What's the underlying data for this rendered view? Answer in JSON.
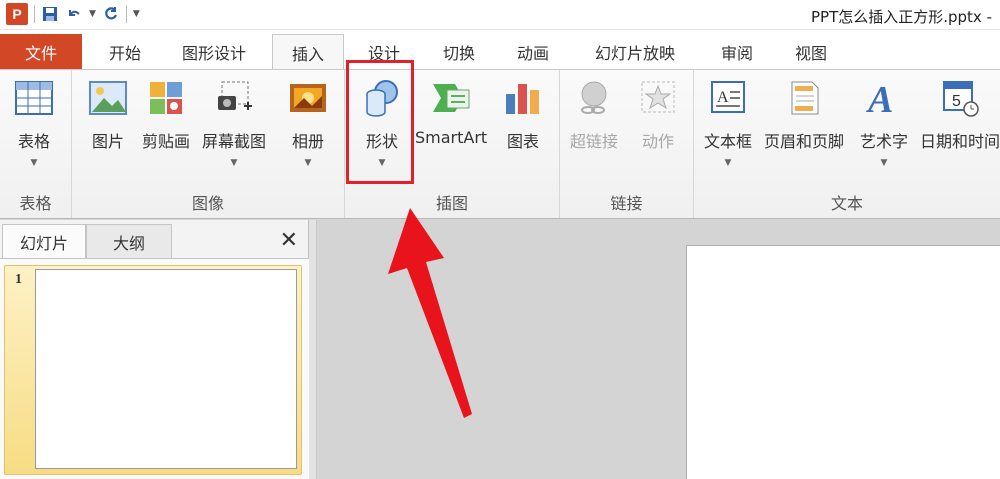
{
  "window": {
    "title": "PPT怎么插入正方形.pptx -",
    "app_icon_letter": "P"
  },
  "file_tab": "文件",
  "tabs": [
    "开始",
    "图形设计",
    "插入",
    "设计",
    "切换",
    "动画",
    "幻灯片放映",
    "审阅",
    "视图"
  ],
  "active_tab": "插入",
  "ribbon": {
    "groups": {
      "tables": "表格",
      "images": "图像",
      "illustrations": "插图",
      "links": "链接",
      "text": "文本"
    },
    "buttons": {
      "table": "表格",
      "picture": "图片",
      "clipart": "剪贴画",
      "screenshot": "屏幕截图",
      "album": "相册",
      "shapes": "形状",
      "smartart": "SmartArt",
      "chart": "图表",
      "hyperlink": "超链接",
      "action": "动作",
      "textbox": "文本框",
      "header_footer": "页眉和页脚",
      "wordart": "艺术字",
      "datetime": "日期和时间"
    }
  },
  "panel": {
    "tab_slides": "幻灯片",
    "tab_outline": "大纲",
    "slide_number": "1"
  },
  "colors": {
    "accent": "#d24726",
    "highlight": "#e0202a"
  }
}
